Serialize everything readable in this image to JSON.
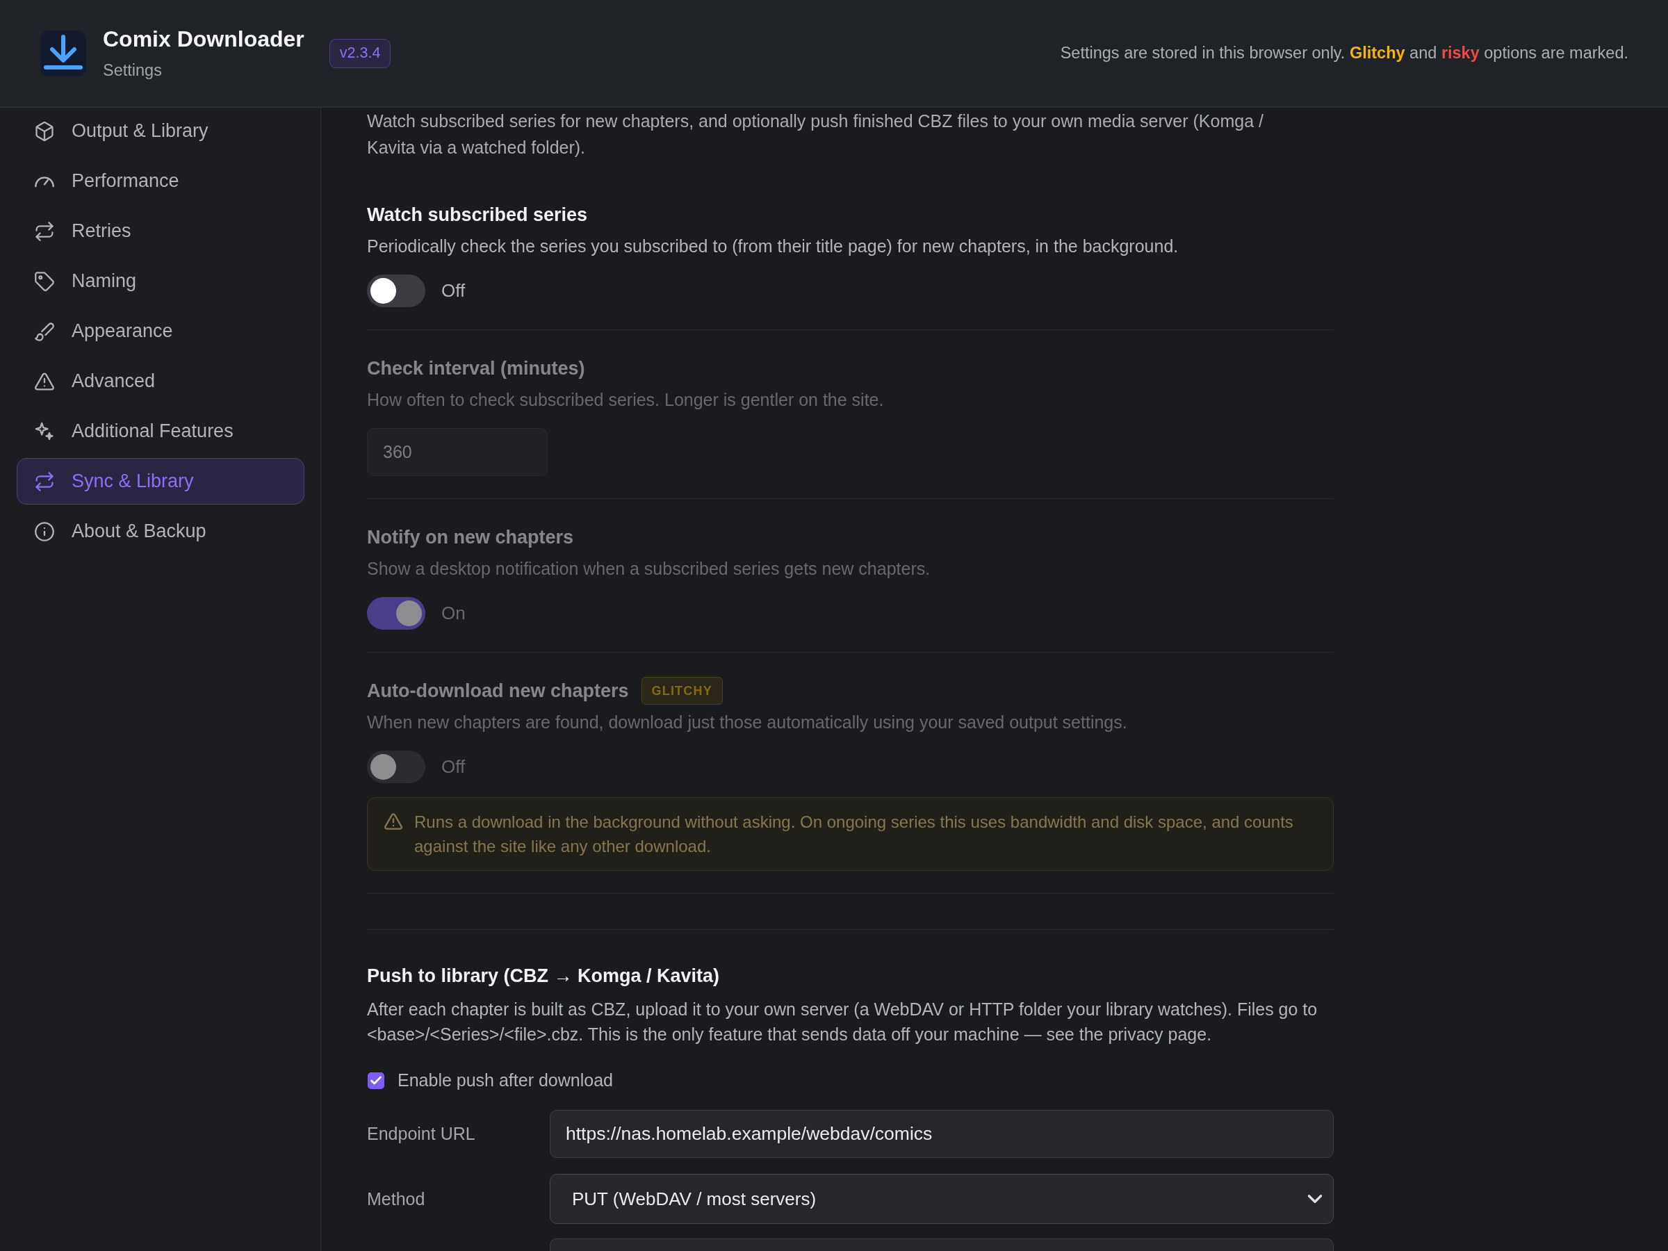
{
  "header": {
    "title": "Comix Downloader",
    "subtitle": "Settings",
    "version": "v2.3.4",
    "notice": [
      {
        "kind": "plain",
        "text": "Settings are stored in this browser only. "
      },
      {
        "kind": "glitchy",
        "text": "Glitchy"
      },
      {
        "kind": "plain",
        "text": " and "
      },
      {
        "kind": "risky",
        "text": "risky"
      },
      {
        "kind": "plain",
        "text": " options are marked."
      }
    ]
  },
  "sidebar": {
    "items": [
      {
        "label": "Output & Library",
        "selected": false
      },
      {
        "label": "Performance",
        "selected": false
      },
      {
        "label": "Retries",
        "selected": false
      },
      {
        "label": "Naming",
        "selected": false
      },
      {
        "label": "Appearance",
        "selected": false
      },
      {
        "label": "Advanced",
        "selected": false
      },
      {
        "label": "Additional Features",
        "selected": false
      },
      {
        "label": "Sync & Library",
        "selected": true
      },
      {
        "label": "About & Backup",
        "selected": false
      }
    ]
  },
  "content": {
    "intro": "Watch subscribed series for new chapters, and optionally push finished CBZ files to your own media server (Komga / Kavita via a watched folder).",
    "settings": [
      {
        "kind": "toggle",
        "title": "Watch subscribed series",
        "description": "Periodically check the series you subscribed to (from their title page) for new chapters, in the background.",
        "disabled": false,
        "on": false,
        "state_label": "Off"
      },
      {
        "kind": "number",
        "title": "Check interval (minutes)",
        "description": "How often to check subscribed series. Longer is gentler on the site.",
        "disabled": true,
        "value": "360"
      },
      {
        "kind": "toggle",
        "title": "Notify on new chapters",
        "description": "Show a desktop notification when a subscribed series gets new chapters.",
        "disabled": true,
        "on": true,
        "state_label": "On"
      },
      {
        "kind": "toggle",
        "title": "Auto-download new chapters",
        "badge": {
          "kind": "glitchy",
          "text": "GLITCHY"
        },
        "description": "When new chapters are found, download just those automatically using your saved output settings.",
        "disabled": true,
        "on": false,
        "state_label": "Off",
        "warning": "Runs a download in the background without asking. On ongoing series this uses bandwidth and disk space, and counts against the site like any other download."
      }
    ],
    "push_section": {
      "title": "Push to library (CBZ → Komga / Kavita)",
      "description": "After each chapter is built as CBZ, upload it to your own server (a WebDAV or HTTP folder your library watches). Files go to <base>/<Series>/<file>.cbz. This is the only feature that sends data off your machine — see the privacy page.",
      "enable_checkbox": {
        "label": "Enable push after download",
        "checked": true
      },
      "fields": [
        {
          "kind": "text",
          "label": "Endpoint URL",
          "value": "https://nas.homelab.example/webdav/comics"
        },
        {
          "kind": "select",
          "label": "Method",
          "value": "PUT (WebDAV / most servers)"
        },
        {
          "kind": "text"
        }
      ]
    }
  }
}
